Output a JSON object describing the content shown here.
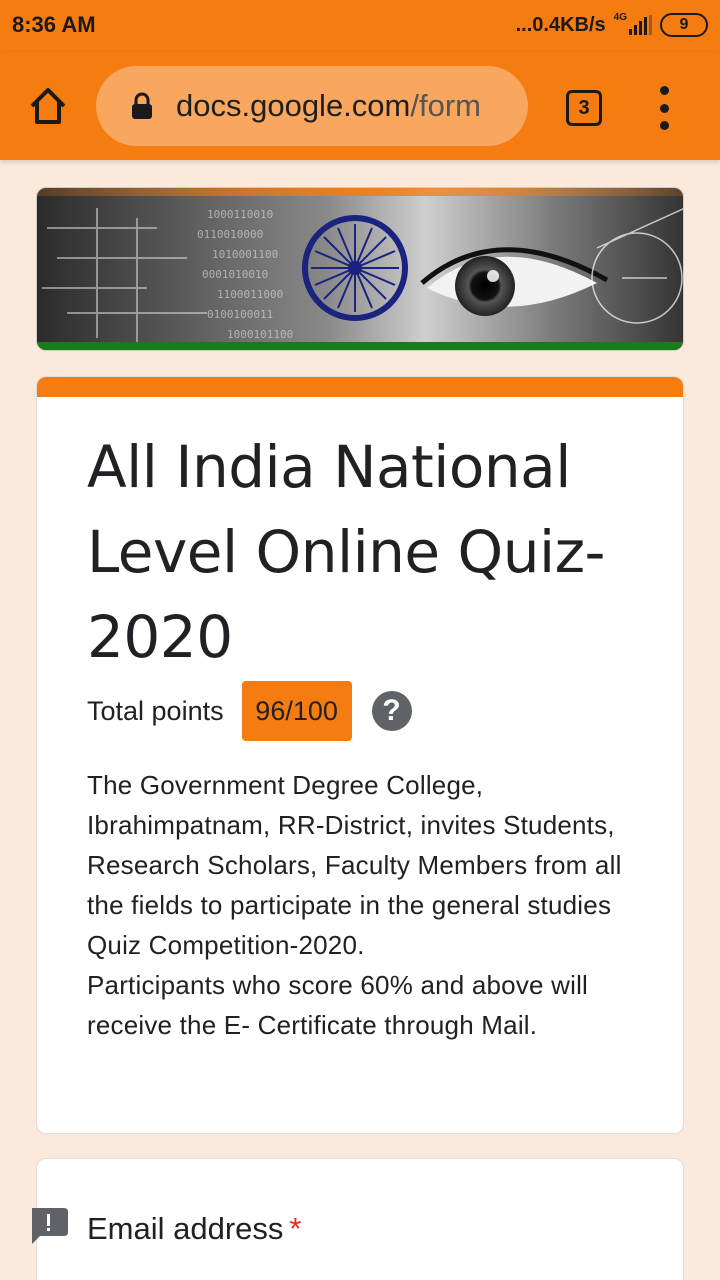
{
  "status_bar": {
    "time": "8:36 AM",
    "net_speed": "...0.4KB/s",
    "network_type": "4G",
    "battery_level": "9"
  },
  "browser": {
    "url_domain": "docs.google.com",
    "url_path": "/form",
    "tab_count": "3",
    "icons": [
      "home-icon",
      "lock-icon",
      "tabs-icon",
      "menu-icon"
    ]
  },
  "form": {
    "title": "All India National Level Online Quiz-2020",
    "points_label": "Total points",
    "score": "96/100",
    "help_symbol": "?",
    "description": "The Government Degree College, Ibrahimpatnam, RR-District, invites Students, Research Scholars, Faculty Members from all the fields to participate in the general studies Quiz Competition-2020.\nParticipants who score 60% and above will receive the E- Certificate through Mail.",
    "email_label": "Email address",
    "required_mark": "*"
  },
  "colors": {
    "accent": "#f47c10",
    "page_background": "#fbe9dc",
    "required": "#d93025"
  }
}
